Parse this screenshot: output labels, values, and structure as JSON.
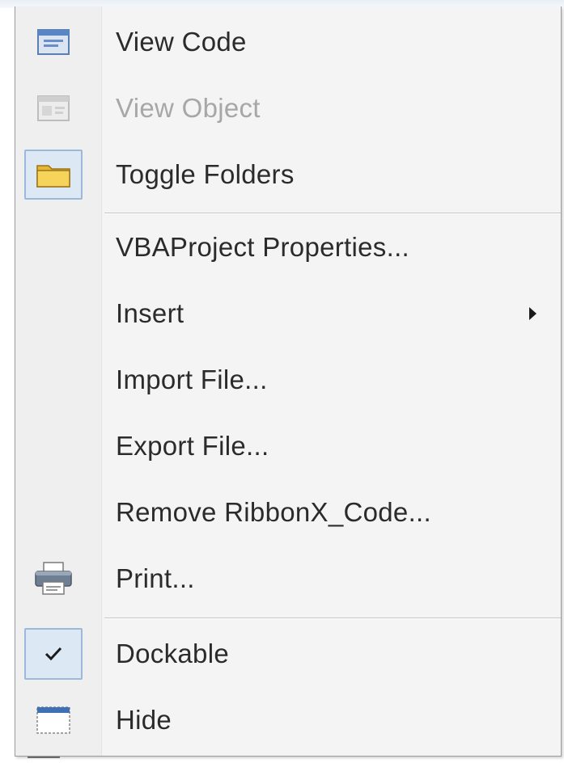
{
  "menu": {
    "items": [
      {
        "label": "View Code",
        "icon": "view-code-icon",
        "enabled": true
      },
      {
        "label": "View Object",
        "icon": "view-object-icon",
        "enabled": false
      },
      {
        "label": "Toggle Folders",
        "icon": "folder-icon",
        "enabled": true
      },
      {
        "label": "VBAProject Properties...",
        "enabled": true
      },
      {
        "label": "Insert",
        "enabled": true,
        "submenu": true
      },
      {
        "label": "Import File...",
        "enabled": true
      },
      {
        "label": "Export File...",
        "enabled": true
      },
      {
        "label": "Remove RibbonX_Code...",
        "enabled": true
      },
      {
        "label": "Print...",
        "icon": "printer-icon",
        "enabled": true
      },
      {
        "label": "Dockable",
        "icon": "checkmark-icon",
        "enabled": true,
        "checked": true
      },
      {
        "label": "Hide",
        "icon": "hide-window-icon",
        "enabled": true
      }
    ]
  },
  "colors": {
    "menu_background": "#f4f4f4",
    "text": "#2b2b2b",
    "disabled_text": "#a7a7a7",
    "icon_highlight": "#dde8f5",
    "icon_highlight_border": "#9cb9dc"
  }
}
